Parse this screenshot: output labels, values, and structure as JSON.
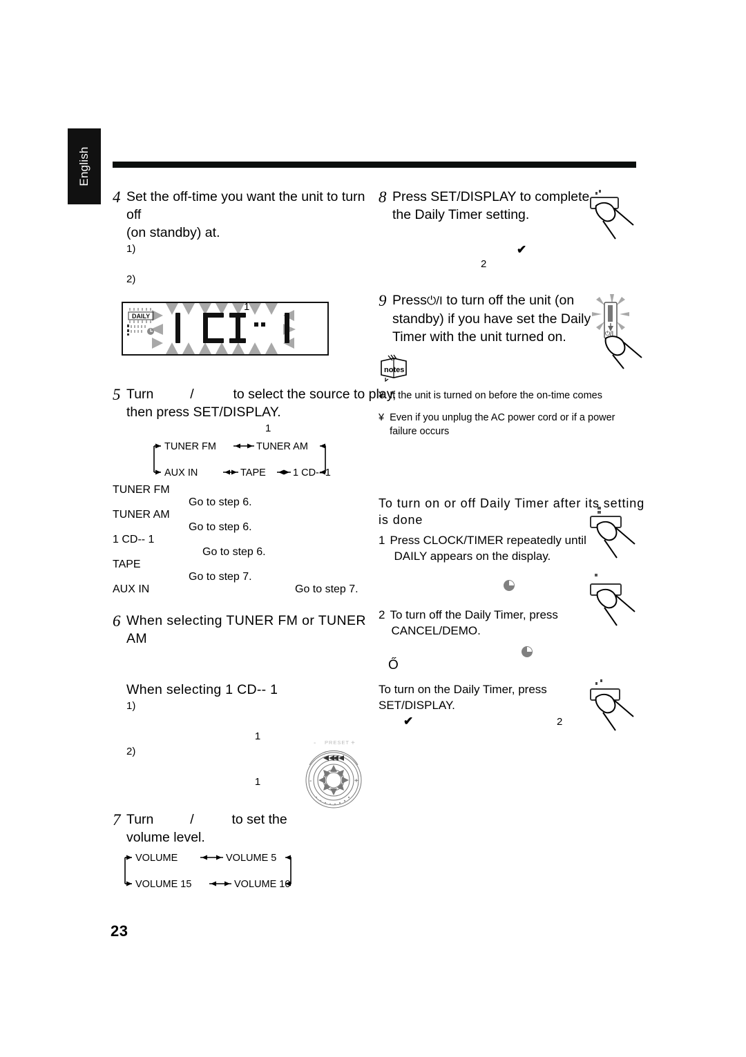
{
  "page": {
    "language_tab": "English",
    "number": "23"
  },
  "left_column": {
    "step4": {
      "num": "4",
      "line1": "Set the off-time you want the unit to turn off",
      "line2": "(on standby) at.",
      "sub1": "1)",
      "sub2": "2)",
      "marker": "1"
    },
    "lcd": {
      "indicator_label": "DAILY",
      "digits": "1 CD--  1",
      "separator": ":",
      "digit_chars": [
        "1",
        "C",
        "D",
        ":",
        "1"
      ]
    },
    "step5": {
      "num": "5",
      "text_a": "Turn",
      "slash": "/",
      "text_b": "to select the source to play,",
      "line2": "then press SET/DISPLAY.",
      "marker": "1"
    },
    "source_cycle": {
      "top": [
        "TUNER FM",
        "TUNER AM"
      ],
      "bottom": [
        "AUX IN",
        "TAPE",
        "1 CD-- 1"
      ]
    },
    "source_list": [
      {
        "name": "TUNER FM",
        "goto": "Go to step 6.",
        "goto_indent": 110
      },
      {
        "name": "TUNER AM",
        "goto": "Go to step 6.",
        "goto_indent": 110
      },
      {
        "name": "1 CD-- 1",
        "goto": "Go to step 6.",
        "goto_indent": 130
      },
      {
        "name": "TAPE",
        "goto": "Go to step 7.",
        "goto_indent": 110
      },
      {
        "name": "AUX IN",
        "goto": "Go to step 7.",
        "goto_indent": 264
      }
    ],
    "step6": {
      "num": "6",
      "heading": "When selecting  TUNER FM  or  TUNER AM",
      "sub_heading": "When selecting  1 CD-- 1",
      "sub1": "1)",
      "sub2": "2)",
      "marker1": "1",
      "marker2": "1"
    },
    "step7": {
      "num": "7",
      "text_a": "Turn",
      "slash": "/",
      "text_b": "to set the",
      "line2": "volume level."
    },
    "volume_cycle": {
      "top": [
        "VOLUME",
        "VOLUME 5"
      ],
      "bottom": [
        "VOLUME 15",
        "VOLUME 10"
      ]
    },
    "knob": {
      "preset_label": "PRESET",
      "minus": "-",
      "plus": "+"
    }
  },
  "right_column": {
    "step8": {
      "num": "8",
      "line1": "Press SET/DISPLAY to complete",
      "line2": "the Daily Timer setting.",
      "check": "✔",
      "marker": "2"
    },
    "step9": {
      "num": "9",
      "text_a": "Press",
      "power_symbol": "⏻/I",
      "text_b": "to turn off the unit (on",
      "line2": "standby) if you have set the Daily",
      "line3": "Timer with the unit turned on."
    },
    "notes": {
      "icon_label": "notes",
      "bullet": "¥",
      "items": [
        "If the unit is turned on before the on-time comes",
        "Even if you unplug the AC power cord or if a power failure occurs"
      ]
    },
    "toggle_section": {
      "heading": "To turn on or off Daily Timer after its setting is done",
      "step1": {
        "num": "1",
        "line1": "Press CLOCK/TIMER repeatedly until",
        "line2": "DAILY  appears on the display."
      },
      "step2": {
        "num": "2",
        "line1": "To turn off the Daily Timer, press",
        "line2": "CANCEL/DEMO."
      },
      "or_symbol": "Ő",
      "step3": {
        "line1": "To turn on the Daily Timer, press",
        "line2": "SET/DISPLAY.",
        "check": "✔",
        "marker": "2"
      }
    }
  },
  "colors": {
    "ink": "#000000",
    "rule": "#0a0e0c",
    "tab_bg": "#111111",
    "blink_gray": "#a8a8a8",
    "icon_gray": "#808080"
  }
}
